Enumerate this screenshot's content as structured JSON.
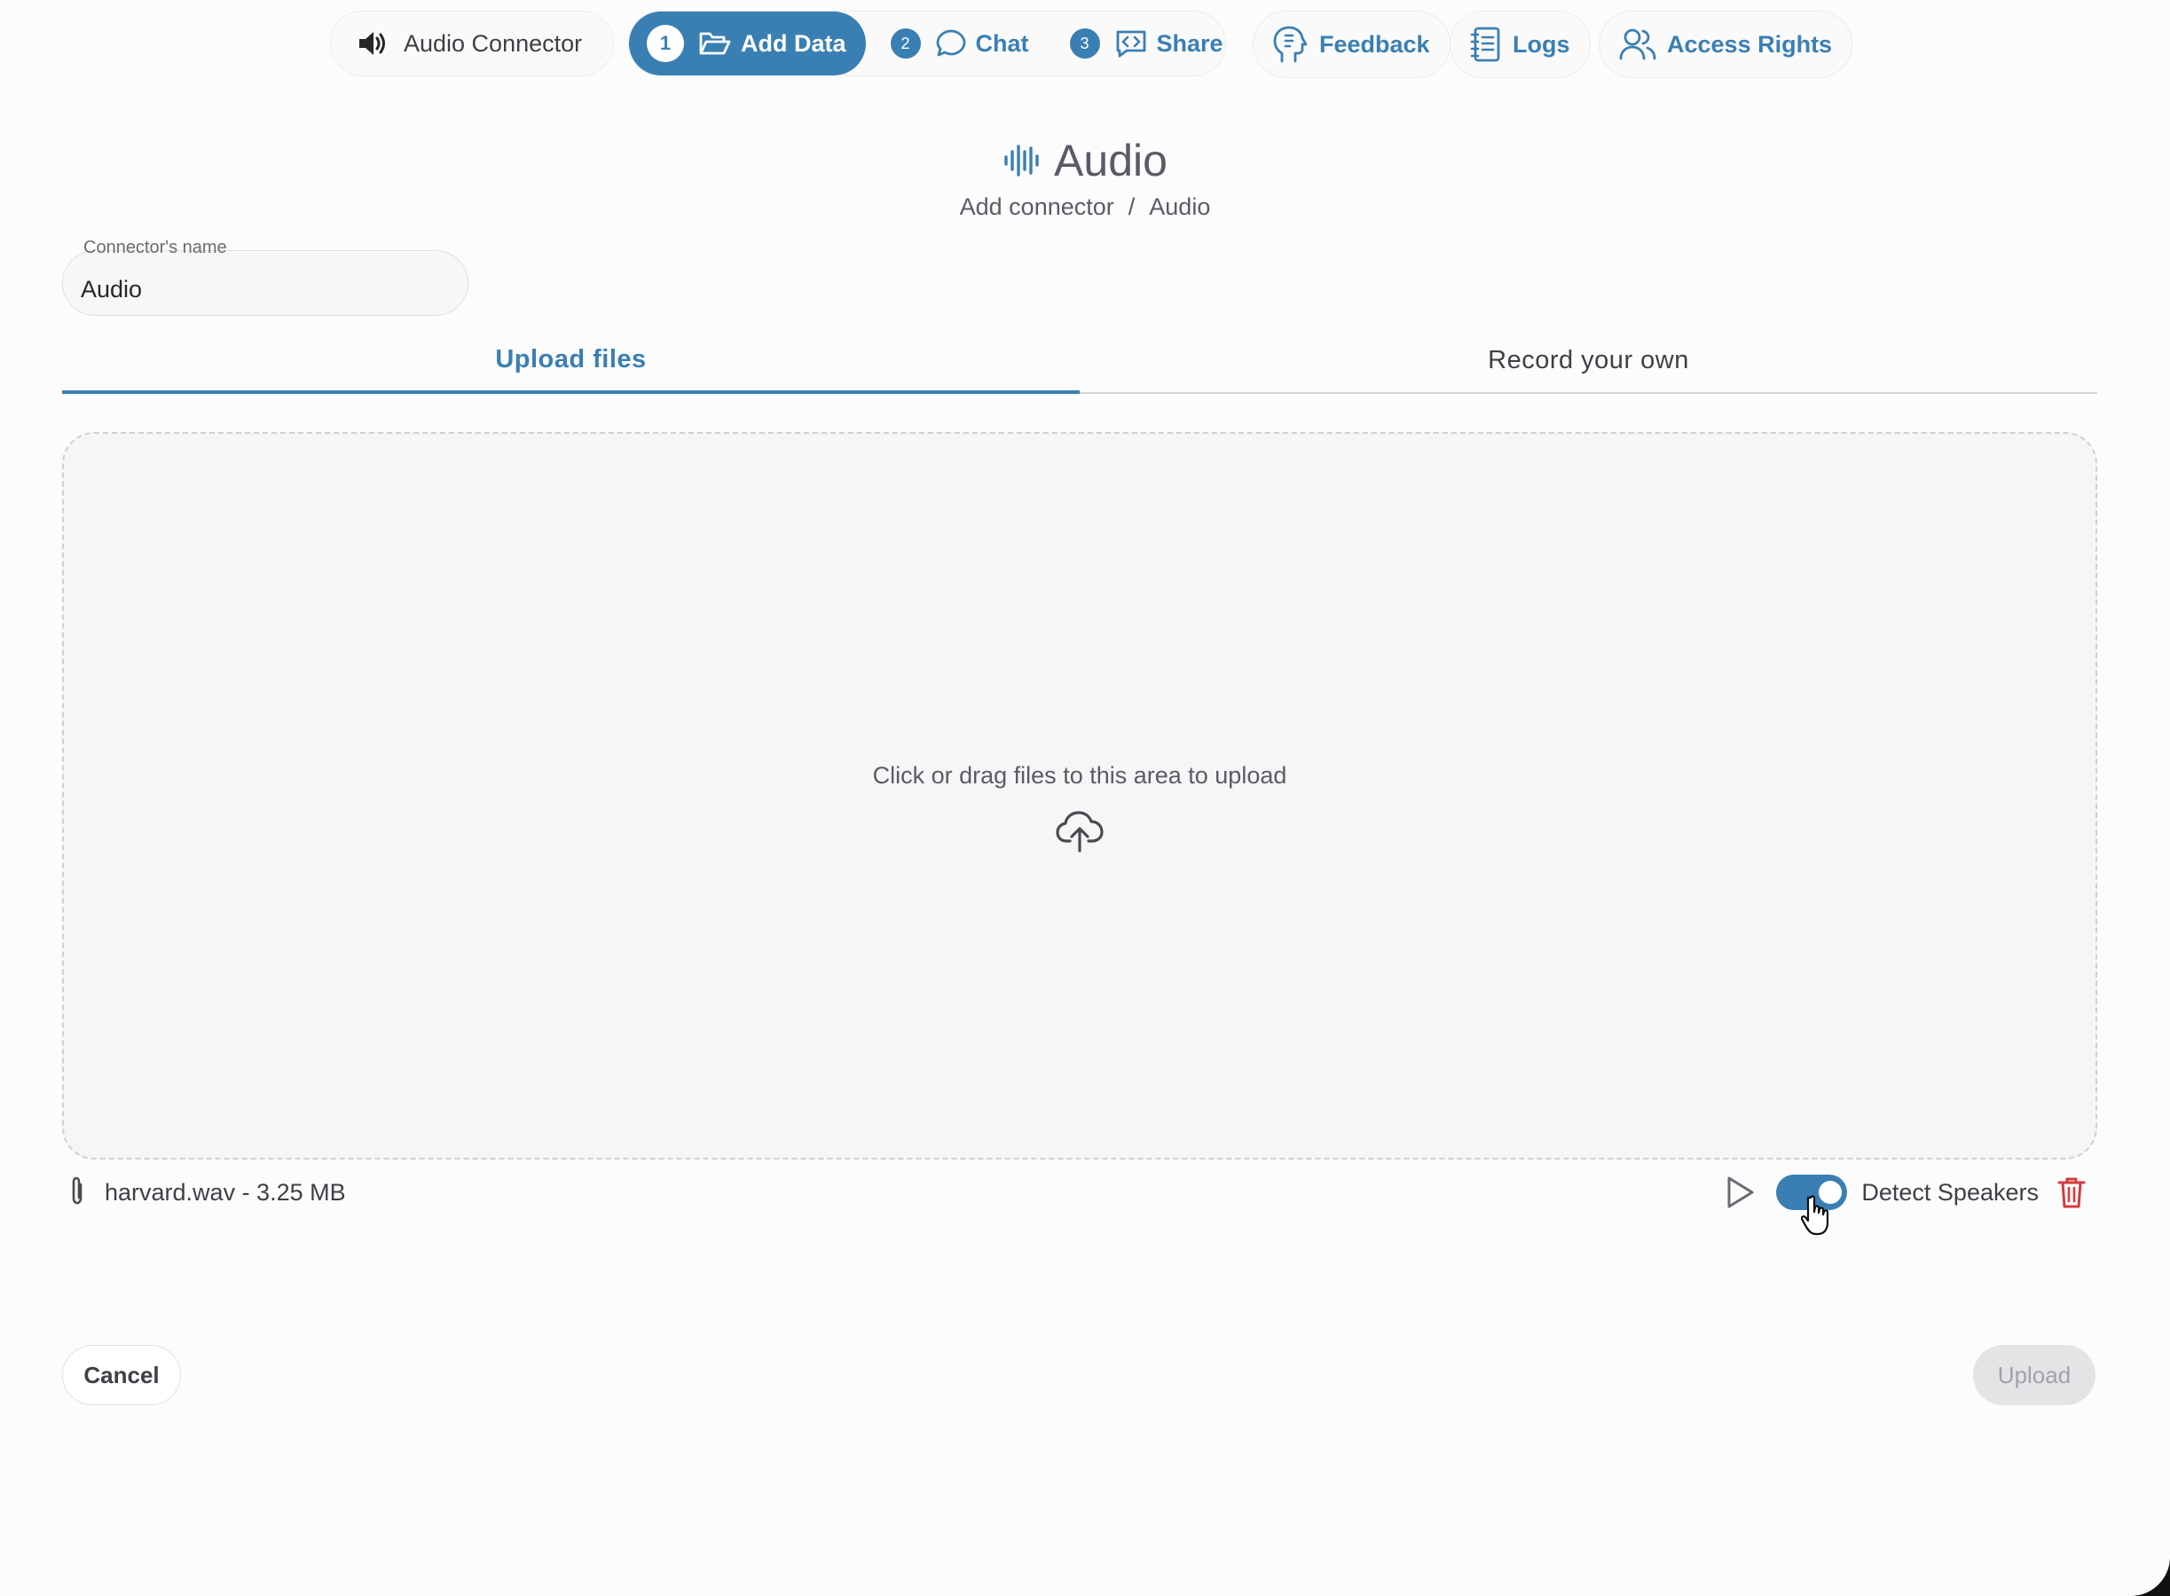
{
  "nav": {
    "connector_label": "Audio Connector",
    "steps": [
      {
        "number": "1",
        "label": "Add Data",
        "icon": "folder-open-icon"
      },
      {
        "number": "2",
        "label": "Chat",
        "icon": "chat-bubble-icon"
      },
      {
        "number": "3",
        "label": "Share",
        "icon": "code-share-icon"
      }
    ],
    "feedback_label": "Feedback",
    "logs_label": "Logs",
    "access_label": "Access Rights"
  },
  "header": {
    "title": "Audio",
    "breadcrumb": [
      "Add connector",
      "Audio"
    ],
    "breadcrumb_sep": "/"
  },
  "form": {
    "name_label": "Connector's name",
    "name_value": "Audio"
  },
  "tabs": [
    {
      "label": "Upload files",
      "active": true
    },
    {
      "label": "Record your own",
      "active": false
    }
  ],
  "dropzone": {
    "hint": "Click or drag files to this area to upload"
  },
  "file": {
    "name": "harvard.wav - 3.25 MB",
    "detect_speakers_label": "Detect Speakers",
    "detect_speakers_on": true
  },
  "actions": {
    "cancel": "Cancel",
    "upload": "Upload"
  },
  "colors": {
    "accent": "#3a7fb4",
    "danger": "#d63b3b",
    "disabled_bg": "#e4e4e7"
  }
}
